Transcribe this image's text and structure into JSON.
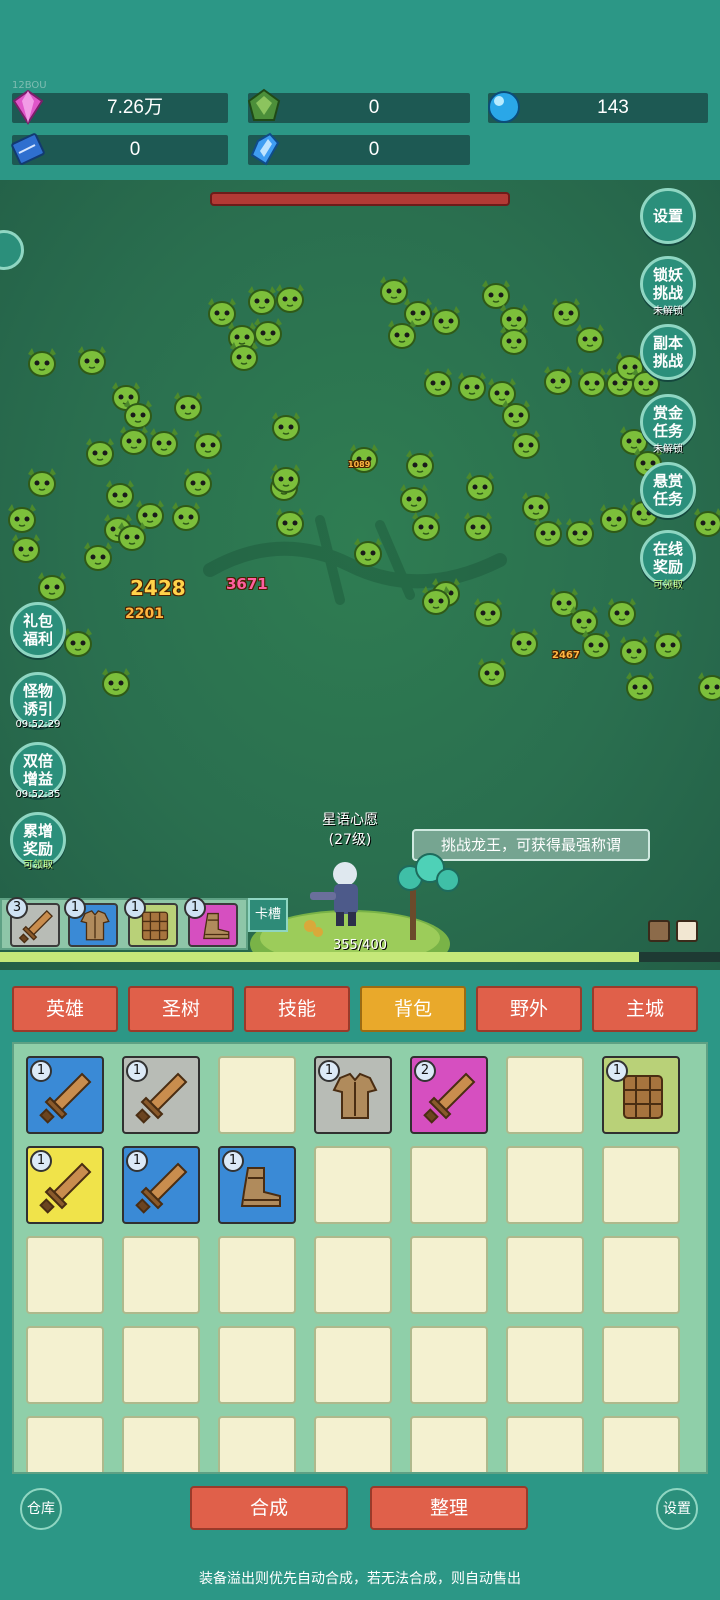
{
  "topbar": {
    "tag": "12BOU",
    "resources": [
      {
        "id": "gem",
        "icon": "pink-diamond-icon",
        "value": "7.26万"
      },
      {
        "id": "green-crystal",
        "icon": "green-crystal-icon",
        "value": "0"
      },
      {
        "id": "blue-orb",
        "icon": "blue-orb-icon",
        "value": "143"
      },
      {
        "id": "book",
        "icon": "blue-book-icon",
        "value": "0"
      },
      {
        "id": "blue-shard",
        "icon": "blue-shard-icon",
        "value": "0"
      }
    ]
  },
  "battle": {
    "damage_numbers": [
      "2428",
      "2201",
      "3671",
      "2467",
      "1089"
    ],
    "hero": {
      "name": "星语心愿",
      "level": "(27级)"
    },
    "challenge_tip": "挑战龙王，可获得最强称谓",
    "xp": {
      "text": "355/400",
      "fraction": 0.8875
    },
    "right_buttons": [
      {
        "label": "设置",
        "sub": ""
      },
      {
        "label": "锁妖挑战",
        "sub": "未解锁"
      },
      {
        "label": "副本挑战",
        "sub": ""
      },
      {
        "label": "赏金任务",
        "sub": "未解锁"
      },
      {
        "label": "悬赏任务",
        "sub": ""
      },
      {
        "label": "在线奖励",
        "sub": "可领取"
      }
    ],
    "left_buttons": [
      {
        "label": "礼包福利",
        "sub": ""
      },
      {
        "label": "怪物诱引",
        "sub": "09:52:29"
      },
      {
        "label": "双倍增益",
        "sub": "09:52:35"
      },
      {
        "label": "累增奖励",
        "sub": "可领取"
      }
    ],
    "card_slots": [
      {
        "level": "3",
        "item": "sword",
        "color": "#b8bcb6"
      },
      {
        "level": "1",
        "item": "armor",
        "color": "#3a8ad6"
      },
      {
        "level": "1",
        "item": "shield",
        "color": "#b9d178"
      },
      {
        "level": "1",
        "item": "boots",
        "color": "#d64fc0"
      }
    ],
    "card_tab_label": "卡槽"
  },
  "tabs": [
    {
      "label": "英雄",
      "active": false
    },
    {
      "label": "圣树",
      "active": false
    },
    {
      "label": "技能",
      "active": false
    },
    {
      "label": "背包",
      "active": true
    },
    {
      "label": "野外",
      "active": false
    },
    {
      "label": "主城",
      "active": false
    }
  ],
  "inventory": [
    {
      "level": "1",
      "item": "sword",
      "color": "#3a8ad6"
    },
    {
      "level": "1",
      "item": "sword",
      "color": "#b8bcb6"
    },
    null,
    {
      "level": "1",
      "item": "armor",
      "color": "#b8bcb6"
    },
    {
      "level": "2",
      "item": "sword",
      "color": "#d64fc0"
    },
    null,
    {
      "level": "1",
      "item": "shield",
      "color": "#b9d178"
    },
    {
      "level": "1",
      "item": "sword",
      "color": "#f0e34a"
    },
    {
      "level": "1",
      "item": "sword",
      "color": "#3a8ad6"
    },
    {
      "level": "1",
      "item": "boots",
      "color": "#3a8ad6"
    }
  ],
  "actions": {
    "warehouse": "仓库",
    "merge": "合成",
    "sort": "整理",
    "settings": "设置"
  },
  "footer_tip": "装备溢出则优先自动合成，若无法合成，则自动售出",
  "colors": {
    "accent": "#2c9786",
    "tab": "#e0604a",
    "tab_active": "#e9a92b"
  }
}
